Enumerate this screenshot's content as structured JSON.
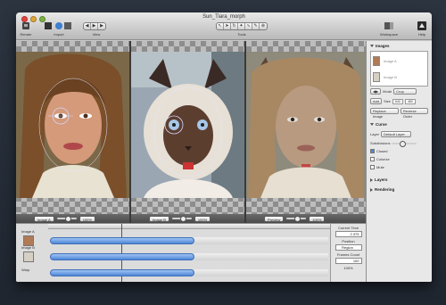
{
  "window": {
    "title": "Sun_Tiara_morph",
    "toolbar": {
      "render_label": "Render",
      "import_label": "Import",
      "view_label": "View",
      "tools_label": "Tools",
      "workspace_label": "Workspace",
      "help_label": "Help"
    }
  },
  "panes": [
    {
      "selector": "Image A",
      "zoom": "100%"
    },
    {
      "selector": "Image B",
      "zoom": "100%"
    },
    {
      "selector": "Preview",
      "zoom": "100%"
    }
  ],
  "timeline": {
    "rows": [
      {
        "name": "Image A"
      },
      {
        "name": "Image B"
      },
      {
        "name": "Warp"
      }
    ],
    "current_time_label": "Current Time",
    "current_time": "2.375",
    "position_label": "Position",
    "position_value": "Region",
    "frame_count_label": "Frames Count",
    "frame_count": "100",
    "zoom_value": "100%"
  },
  "inspector": {
    "images_label": "Images",
    "image_a_label": "Image A",
    "image_b_label": "Image B",
    "mode_label": "Mode",
    "mode_value": "Crop",
    "size_label": "Size",
    "width_value": "640",
    "height_value": "480",
    "add_label": "Add",
    "replace_label": "Replace Image",
    "reverse_label": "Reverse Order",
    "curve_label": "Curve",
    "layer_label": "Layer",
    "layer_value": "Default Layer",
    "subdivisions_label": "Subdivisions",
    "closed_label": "Closed",
    "colorize_label": "Colorize",
    "mute_label": "Mute",
    "layers_label": "Layers",
    "rendering_label": "Rendering"
  },
  "colors": {
    "accent": "#4f86d8",
    "track": "#6b9be2"
  }
}
